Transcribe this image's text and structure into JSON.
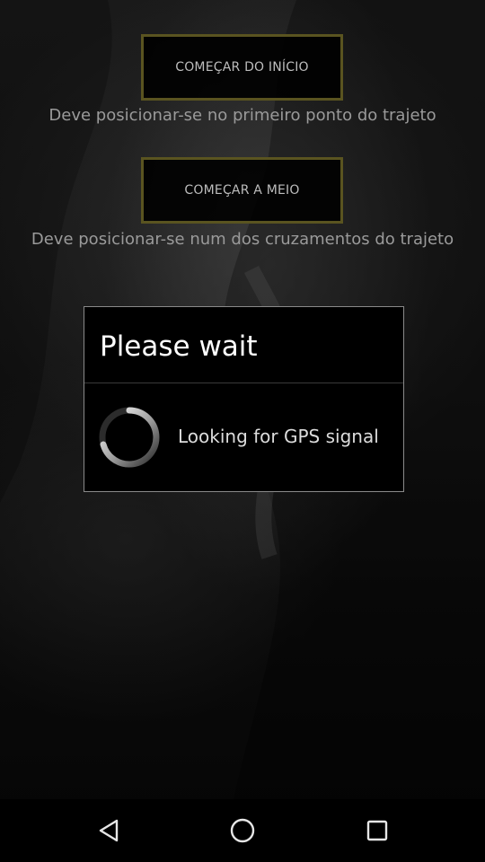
{
  "buttons": {
    "start_beginning": "COMEÇAR DO INÍCIO",
    "start_middle": "COMEÇAR A MEIO"
  },
  "hints": {
    "start_beginning": "Deve posicionar-se no primeiro ponto do trajeto",
    "start_middle": "Deve posicionar-se num dos cruzamentos do trajeto"
  },
  "dialog": {
    "title": "Please wait",
    "message": "Looking for GPS signal"
  },
  "navbar": {
    "back_icon": "back-triangle-icon",
    "home_icon": "home-circle-icon",
    "recent_icon": "recent-apps-square-icon"
  },
  "colors": {
    "button_border": "#5a5420",
    "button_text": "#bdbdbd",
    "hint_text": "#9a9a9a",
    "dialog_border": "#8a8a8a"
  }
}
